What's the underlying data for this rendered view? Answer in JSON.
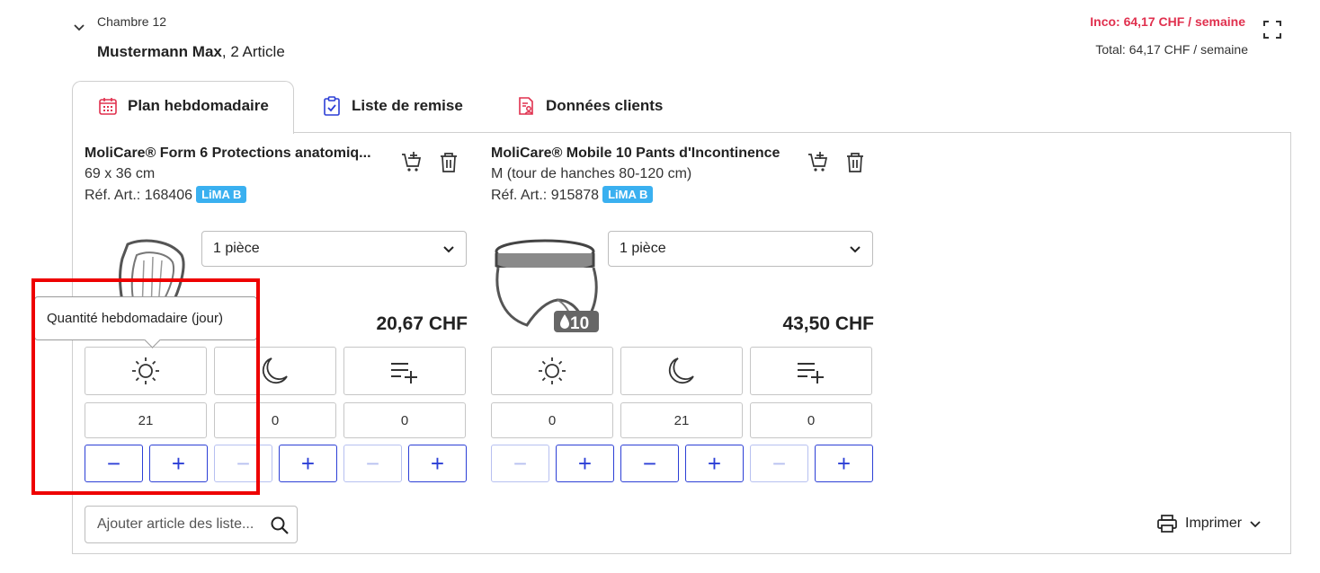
{
  "header": {
    "room": "Chambre 12",
    "patient_name": "Mustermann Max",
    "patient_articles": ", 2 Article",
    "inco_summary": "Inco: 64,17 CHF / semaine",
    "total_summary": "Total: 64,17 CHF / semaine"
  },
  "tabs": [
    {
      "label": "Plan hebdomadaire",
      "icon": "calendar-icon",
      "active": true
    },
    {
      "label": "Liste de remise",
      "icon": "clipboard-check-icon",
      "active": false
    },
    {
      "label": "Données clients",
      "icon": "client-data-icon",
      "active": false
    }
  ],
  "products": [
    {
      "name": "MoliCare® Form 6 Protections anatomiq...",
      "size": "69 x 36 cm",
      "ref": "Réf. Art.: 168406",
      "badge": "LiMA B",
      "unit": "1 pièce",
      "price": "20,67 CHF",
      "quantities": {
        "day": "21",
        "night": "0",
        "extra": "0"
      }
    },
    {
      "name": "MoliCare® Mobile 10 Pants d'Incontinence",
      "size": "M (tour de hanches 80-120 cm)",
      "ref": "Réf. Art.: 915878",
      "badge": "LiMA B",
      "unit": "1 pièce",
      "price": "43,50 CHF",
      "drop_level": "10",
      "quantities": {
        "day": "0",
        "night": "21",
        "extra": "0"
      }
    }
  ],
  "tooltip": "Quantité hebdomadaire (jour)",
  "search": {
    "placeholder": "Ajouter article des liste..."
  },
  "print": {
    "label": "Imprimer"
  },
  "colors": {
    "accent_red": "#e0304e",
    "button_blue": "#2c3fd6",
    "badge_blue": "#3ab0f0",
    "highlight": "#ee0000"
  }
}
